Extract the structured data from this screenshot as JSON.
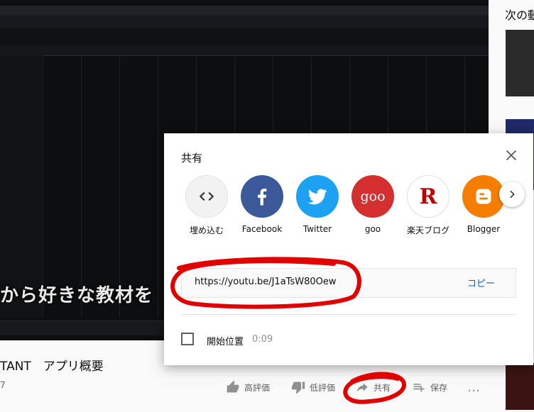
{
  "player": {
    "subtitle_text": "から好きな教材を"
  },
  "sidebar": {
    "title": "次の動"
  },
  "video": {
    "title": "TANT　アプリ概要",
    "view_count": "7"
  },
  "actions": {
    "like_label": "高評価",
    "dislike_label": "低評価",
    "share_label": "共有",
    "save_label": "保存",
    "more_label": "…"
  },
  "share_dialog": {
    "title": "共有",
    "targets": [
      {
        "label": "埋め込む",
        "icon": "embed-icon"
      },
      {
        "label": "Facebook",
        "icon": "facebook-icon"
      },
      {
        "label": "Twitter",
        "icon": "twitter-icon"
      },
      {
        "label": "goo",
        "icon": "goo-icon",
        "icon_text": "goo"
      },
      {
        "label": "楽天ブログ",
        "icon": "rakuten-icon",
        "icon_text": "R"
      },
      {
        "label": "Blogger",
        "icon": "blogger-icon"
      }
    ],
    "url": "https://youtu.be/J1aTsW80Oew",
    "copy_label": "コピー",
    "start_at_label": "開始位置",
    "start_at_time": "0:09"
  },
  "colors": {
    "accent_blue": "#065fd4",
    "annotation_red": "#e00000",
    "facebook": "#3b5998",
    "twitter": "#1da1f2",
    "goo": "#d32f2f",
    "blogger": "#f57d00"
  }
}
